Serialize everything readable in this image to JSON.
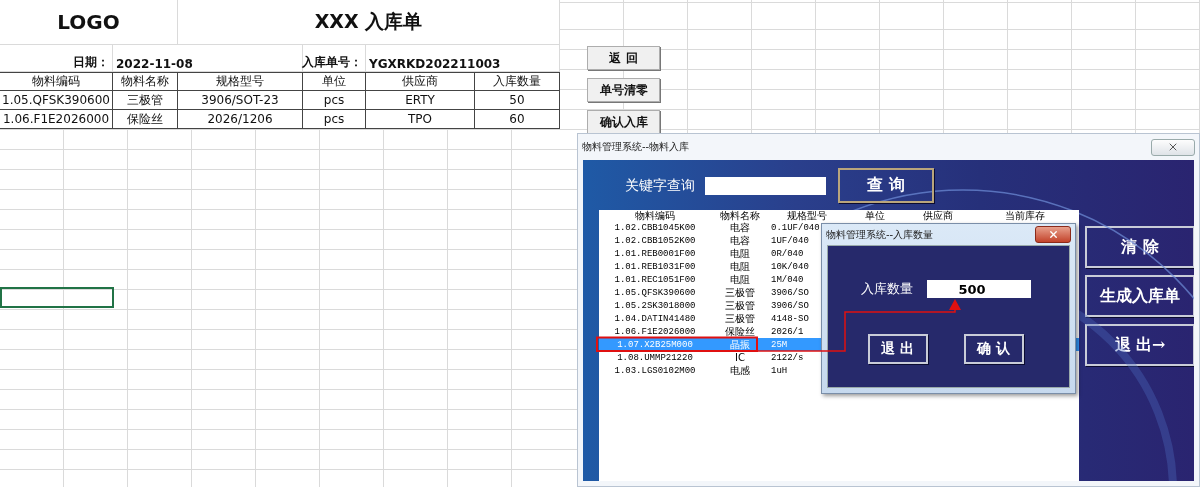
{
  "sheet": {
    "logo": "LOGO",
    "title": "XXX 入库单",
    "date_label": "日期：",
    "date": "2022-11-08",
    "order_label": "入库单号：",
    "order_no": "YGXRKD202211003",
    "columns": [
      "物料编码",
      "物料名称",
      "规格型号",
      "单位",
      "供应商",
      "入库数量"
    ],
    "rows": [
      [
        "1.05.QFSK390600",
        "三极管",
        "3906/SOT-23",
        "pcs",
        "ERTY",
        "50"
      ],
      [
        "1.06.F1E2026000",
        "保险丝",
        "2026/1206",
        "pcs",
        "TPO",
        "60"
      ]
    ]
  },
  "sheet_buttons": [
    "返 回",
    "单号清零",
    "确认入库"
  ],
  "main_window": {
    "title": "物料管理系统--物料入库",
    "search_label": "关键字查询",
    "search_button": "查 询",
    "list": {
      "columns": [
        "物料编码",
        "物料名称",
        "规格型号",
        "单位",
        "供应商",
        "当前库存"
      ],
      "rows": [
        {
          "code": "1.02.CBB1045K00",
          "name": "电容",
          "spec": "0.1UF/040",
          "selected": false
        },
        {
          "code": "1.02.CBB1052K00",
          "name": "电容",
          "spec": "1UF/040",
          "selected": false
        },
        {
          "code": "1.01.REB0001F00",
          "name": "电阻",
          "spec": "0R/040",
          "selected": false
        },
        {
          "code": "1.01.REB1031F00",
          "name": "电阻",
          "spec": "10K/040",
          "selected": false
        },
        {
          "code": "1.01.REC1051F00",
          "name": "电阻",
          "spec": "1M/040",
          "selected": false
        },
        {
          "code": "1.05.QFSK390600",
          "name": "三极管",
          "spec": "3906/SO",
          "selected": false
        },
        {
          "code": "1.05.2SK3018000",
          "name": "三极管",
          "spec": "3906/SO",
          "selected": false
        },
        {
          "code": "1.04.DATIN41480",
          "name": "三极管",
          "spec": "4148-SO",
          "selected": false
        },
        {
          "code": "1.06.F1E2026000",
          "name": "保险丝",
          "spec": "2026/1",
          "selected": false
        },
        {
          "code": "1.07.X2B25M000",
          "name": "晶振",
          "spec": "25M",
          "selected": true
        },
        {
          "code": "1.08.UMMP21220",
          "name": "IC",
          "spec": "2122/s",
          "selected": false
        },
        {
          "code": "1.03.LGS0102M00",
          "name": "电感",
          "spec": "1uH",
          "selected": false
        }
      ]
    },
    "buttons": [
      "清 除",
      "生成入库单",
      "退 出→"
    ]
  },
  "quantity_dialog": {
    "title": "物料管理系统--入库数量",
    "label": "入库数量",
    "value": "500",
    "buttons": [
      "退 出",
      "确 认"
    ]
  }
}
